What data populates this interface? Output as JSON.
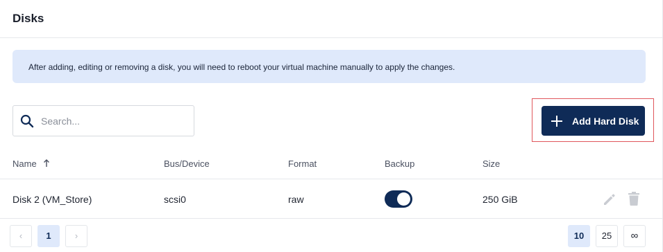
{
  "panel": {
    "title": "Disks"
  },
  "notice": {
    "text": "After adding, editing or removing a disk, you will need to reboot your virtual machine manually to apply the changes."
  },
  "search": {
    "placeholder": "Search...",
    "value": ""
  },
  "actions": {
    "add_label": "Add Hard Disk"
  },
  "table": {
    "columns": [
      "Name",
      "Bus/Device",
      "Format",
      "Backup",
      "Size"
    ],
    "sort": {
      "column": "Name",
      "direction": "ascending"
    },
    "rows": [
      {
        "name": "Disk 2 (VM_Store)",
        "bus": "scsi0",
        "format": "raw",
        "backup": true,
        "size": "250 GiB"
      }
    ]
  },
  "pagination": {
    "prev": "‹",
    "next": "›",
    "pages": [
      "1"
    ],
    "current_page": "1",
    "page_sizes": [
      "10",
      "25",
      "∞"
    ],
    "selected_size": "10"
  },
  "colors": {
    "accent": "#0f2b57",
    "notice_bg": "#dfe9fb",
    "highlight": "#e0565b"
  }
}
